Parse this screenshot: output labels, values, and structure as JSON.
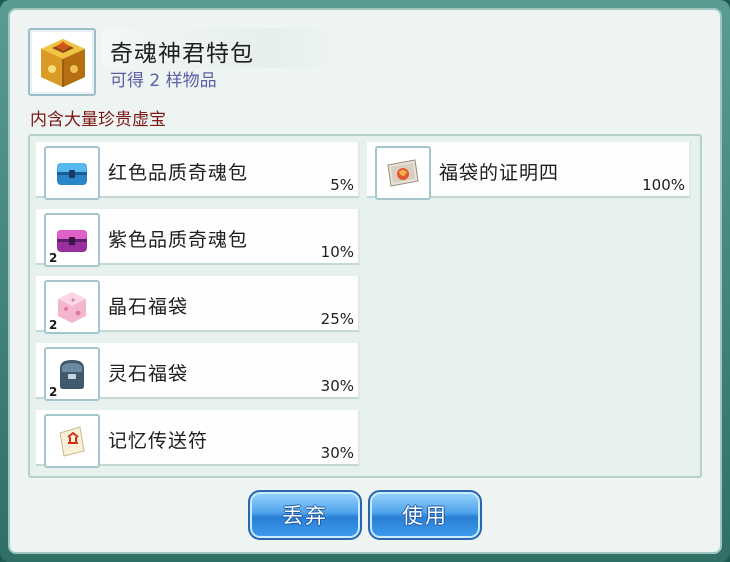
{
  "pack": {
    "title": "奇魂神君特包",
    "subtitle": "可得 2 样物品",
    "description": "内含大量珍贵虚宝",
    "icon": "golden-treasure-box-icon"
  },
  "items": [
    {
      "name": "红色品质奇魂包",
      "chance": "5%",
      "count": "",
      "icon": "blue-chest-icon"
    },
    {
      "name": "紫色品质奇魂包",
      "chance": "10%",
      "count": "2",
      "icon": "purple-chest-icon"
    },
    {
      "name": "晶石福袋",
      "chance": "25%",
      "count": "2",
      "icon": "pink-crystal-bag-icon"
    },
    {
      "name": "灵石福袋",
      "chance": "30%",
      "count": "2",
      "icon": "dark-stone-bag-icon"
    },
    {
      "name": "记忆传送符",
      "chance": "30%",
      "count": "",
      "icon": "teleport-talisman-icon"
    },
    {
      "name": "福袋的证明四",
      "chance": "100%",
      "count": "",
      "icon": "lucky-bag-certificate-icon"
    }
  ],
  "buttons": {
    "discard_label": "丢弃",
    "use_label": "使用"
  }
}
